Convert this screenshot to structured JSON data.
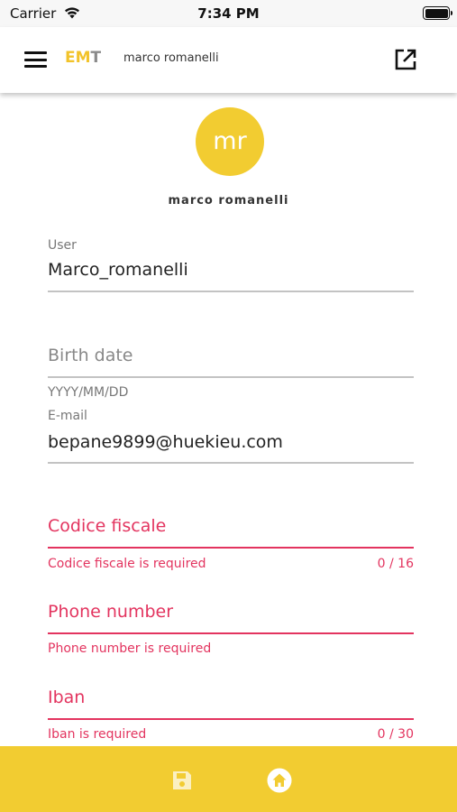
{
  "status_bar": {
    "carrier": "Carrier",
    "time": "7:34 PM"
  },
  "app_bar": {
    "logo": {
      "letters": [
        "E",
        "M",
        "T"
      ],
      "colors": [
        "#f2c32a",
        "#f2c32a",
        "#8a8a8a"
      ]
    },
    "user_name": "marco romanelli",
    "icons": {
      "menu": "menu-icon",
      "open": "open-in-new-icon"
    }
  },
  "profile": {
    "initials": "mr",
    "name": "marco romanelli",
    "avatar_color": "#f2cc31"
  },
  "form": {
    "user": {
      "label": "User",
      "value": "Marco_romanelli"
    },
    "birth_date": {
      "placeholder": "Birth date",
      "hint": "YYYY/MM/DD"
    },
    "email": {
      "label": "E-mail",
      "value": "bepane9899@huekieu.com"
    },
    "codice_fiscale": {
      "placeholder": "Codice fiscale",
      "error": "Codice fiscale is required",
      "counter": "0 / 16"
    },
    "phone": {
      "placeholder": "Phone number",
      "error": "Phone number is required"
    },
    "iban": {
      "placeholder": "Iban",
      "error": "Iban is required",
      "counter": "0 / 30"
    }
  },
  "bottom_bar": {
    "icons": {
      "save": "save-icon",
      "home": "home-icon"
    },
    "color": "#f2cc31"
  },
  "colors": {
    "accent": "#f2cc31",
    "error": "#e3345f"
  }
}
